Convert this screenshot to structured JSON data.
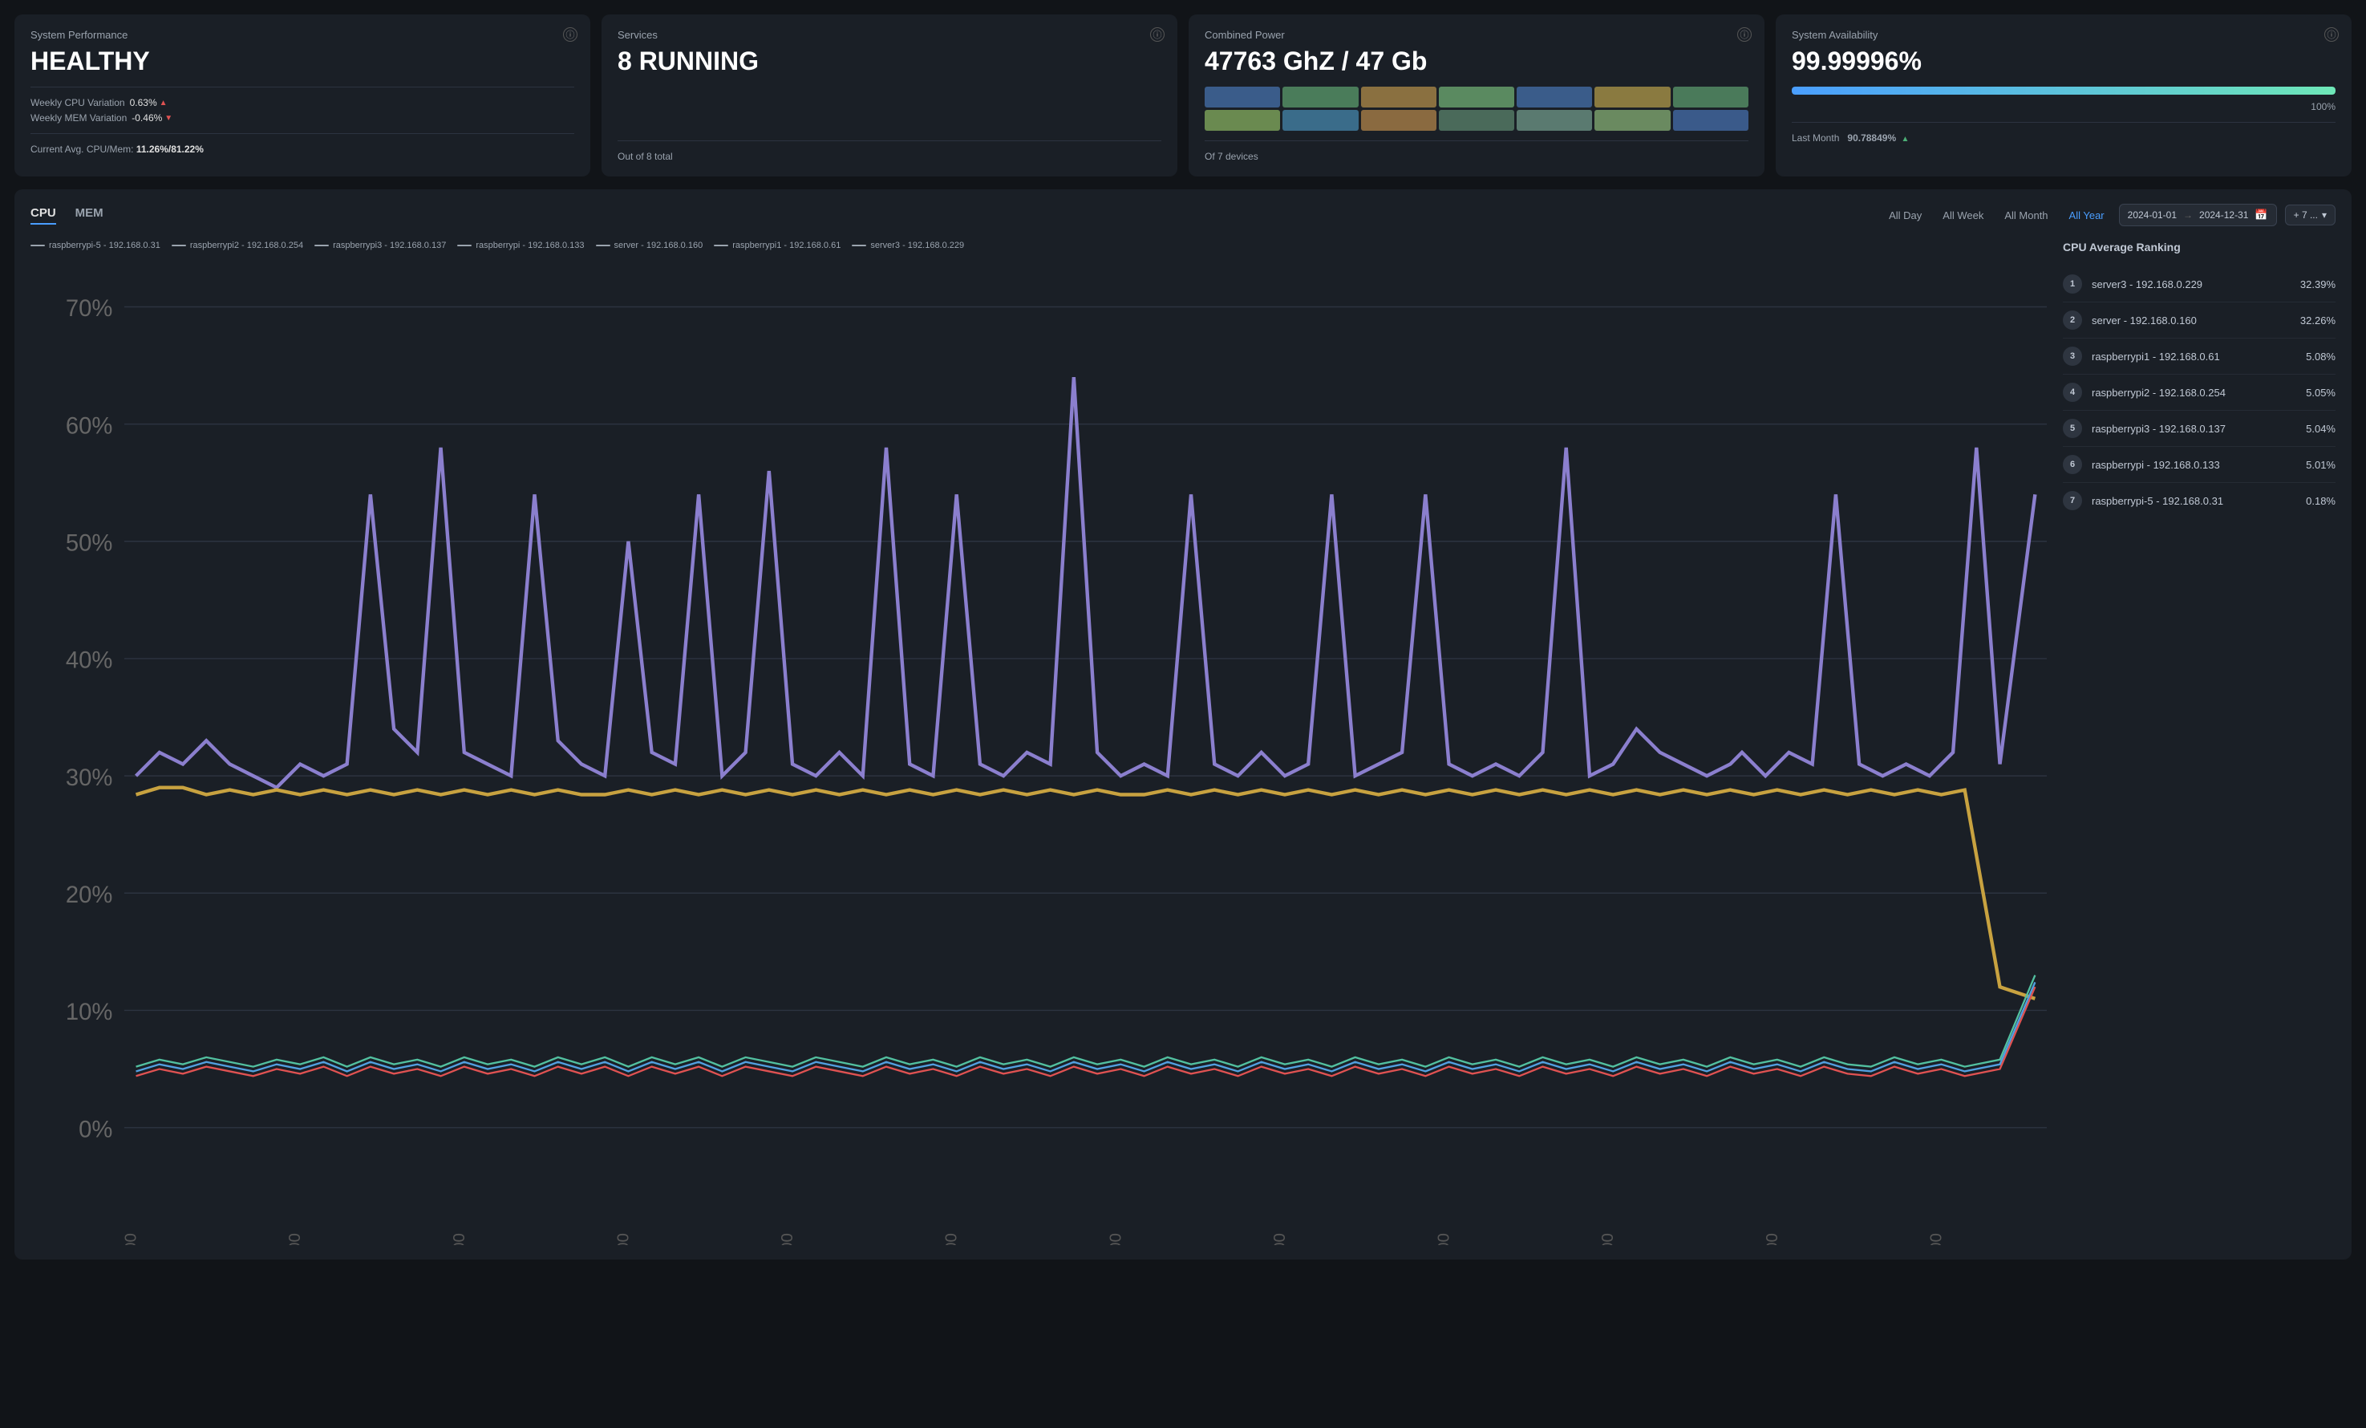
{
  "cards": {
    "system_performance": {
      "title": "System Performance",
      "status": "HEALTHY",
      "weekly_cpu_label": "Weekly CPU Variation",
      "weekly_cpu_value": "0.63%",
      "weekly_cpu_trend": "up",
      "weekly_mem_label": "Weekly MEM Variation",
      "weekly_mem_value": "-0.46%",
      "weekly_mem_trend": "down",
      "footer_label": "Current Avg. CPU/Mem:",
      "footer_value": "11.26%/81.22%"
    },
    "services": {
      "title": "Services",
      "status": "8 RUNNING",
      "footer": "Out of  8 total"
    },
    "combined_power": {
      "title": "Combined Power",
      "status": "47763 GhZ / 47 Gb",
      "footer": "Of 7 devices"
    },
    "system_availability": {
      "title": "System Availability",
      "status": "99.99996%",
      "bar_pct": 100,
      "bar_label": "100%",
      "last_month_label": "Last Month",
      "last_month_value": "90.78849%",
      "last_month_trend": "up"
    }
  },
  "main_panel": {
    "tabs": [
      {
        "id": "cpu",
        "label": "CPU",
        "active": true
      },
      {
        "id": "mem",
        "label": "MEM",
        "active": false
      }
    ],
    "time_buttons": [
      {
        "id": "all_day",
        "label": "All Day",
        "active": false
      },
      {
        "id": "all_week",
        "label": "All Week",
        "active": false
      },
      {
        "id": "all_month",
        "label": "All Month",
        "active": false
      },
      {
        "id": "all_year",
        "label": "All Year",
        "active": true
      }
    ],
    "date_start": "2024-01-01",
    "date_end": "2024-12-31",
    "filter_label": "+ 7 ...",
    "chart_title": "CPU Average Ranking",
    "legend": [
      {
        "name": "raspberrypi-5 - 192.168.0.31",
        "color": "#9aa3ae"
      },
      {
        "name": "raspberrypi2 - 192.168.0.254",
        "color": "#9aa3ae"
      },
      {
        "name": "raspberrypi3 - 192.168.0.137",
        "color": "#9aa3ae"
      },
      {
        "name": "raspberrypi - 192.168.0.133",
        "color": "#9aa3ae"
      },
      {
        "name": "server - 192.168.0.160",
        "color": "#9aa3ae"
      },
      {
        "name": "raspberrypi1 - 192.168.0.61",
        "color": "#9aa3ae"
      },
      {
        "name": "server3 - 192.168.0.229",
        "color": "#9aa3ae"
      }
    ],
    "y_labels": [
      "70%",
      "60%",
      "50%",
      "40%",
      "30%",
      "20%",
      "10%",
      "0%"
    ],
    "ranking": [
      {
        "rank": 1,
        "name": "server3 - 192.168.0.229",
        "value": "32.39%"
      },
      {
        "rank": 2,
        "name": "server - 192.168.0.160",
        "value": "32.26%"
      },
      {
        "rank": 3,
        "name": "raspberrypi1 - 192.168.0.61",
        "value": "5.08%"
      },
      {
        "rank": 4,
        "name": "raspberrypi2 - 192.168.0.254",
        "value": "5.05%"
      },
      {
        "rank": 5,
        "name": "raspberrypi3 - 192.168.0.137",
        "value": "5.04%"
      },
      {
        "rank": 6,
        "name": "raspberrypi - 192.168.0.133",
        "value": "5.01%"
      },
      {
        "rank": 7,
        "name": "raspberrypi-5 - 192.168.0.31",
        "value": "0.18%"
      }
    ]
  }
}
